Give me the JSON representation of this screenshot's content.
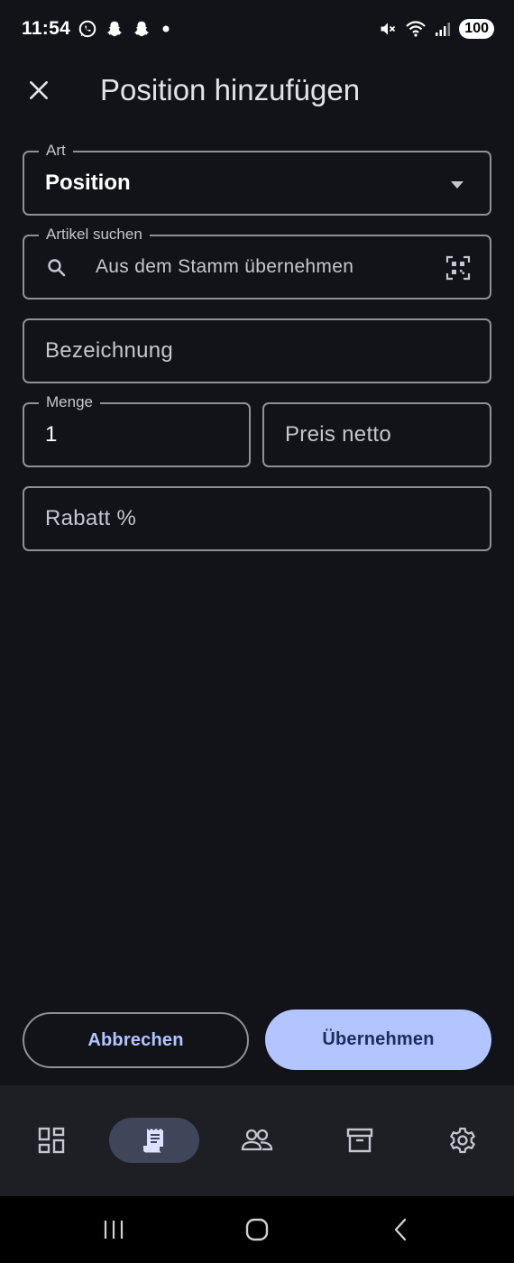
{
  "status_bar": {
    "time": "11:54",
    "battery": "100"
  },
  "app_bar": {
    "close_icon": "close-icon",
    "title": "Position hinzufügen"
  },
  "form": {
    "art": {
      "label": "Art",
      "value": "Position"
    },
    "artikel": {
      "label": "Artikel suchen",
      "placeholder": "Aus dem Stamm übernehmen"
    },
    "bezeichnung": {
      "placeholder": "Bezeichnung"
    },
    "menge": {
      "label": "Menge",
      "value": "1"
    },
    "preis": {
      "placeholder": "Preis netto"
    },
    "rabatt": {
      "placeholder": "Rabatt %"
    }
  },
  "actions": {
    "cancel_label": "Abbrechen",
    "confirm_label": "Übernehmen"
  },
  "bottom_nav": {
    "items": [
      {
        "icon": "dashboard-icon",
        "active": false
      },
      {
        "icon": "receipt-icon",
        "active": true
      },
      {
        "icon": "people-icon",
        "active": false
      },
      {
        "icon": "archive-icon",
        "active": false
      },
      {
        "icon": "settings-icon",
        "active": false
      }
    ]
  },
  "colors": {
    "background": "#121318",
    "outline": "#8f909a",
    "primary": "#b2c5ff",
    "on_primary": "#1b2d5c",
    "nav_background": "#1e1f25",
    "nav_active_indicator": "#404659"
  }
}
